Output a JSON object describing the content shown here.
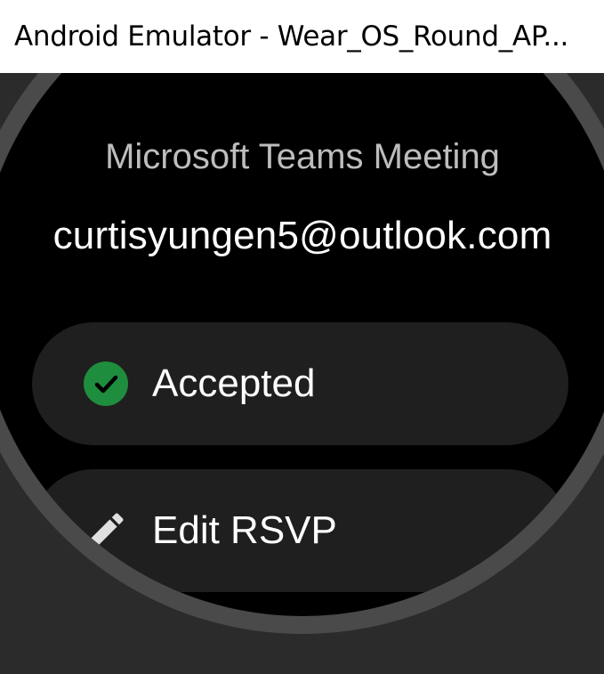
{
  "window": {
    "title": "Android Emulator - Wear_OS_Round_AP..."
  },
  "event_details": {
    "organizer_text": "Microsoft Teams Meeting",
    "email": "curtisyungen5@outlook.com"
  },
  "actions": [
    {
      "label": "Accepted",
      "icon": "check-circle-icon",
      "icon_color": "#1e8e3e"
    },
    {
      "label": "Edit RSVP",
      "icon": "pencil-icon",
      "icon_color": "#e0e0e0"
    }
  ]
}
